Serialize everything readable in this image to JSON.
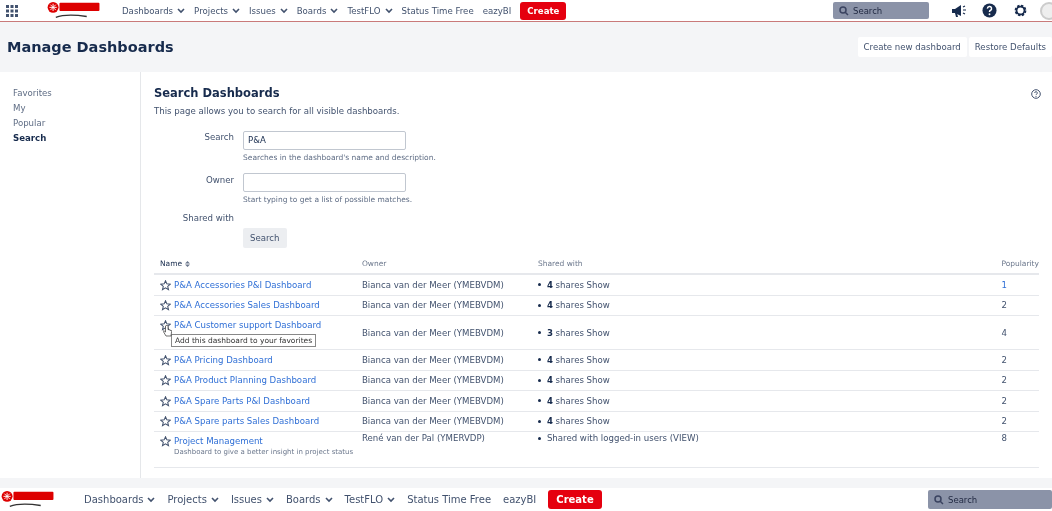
{
  "top_nav": {
    "items": [
      {
        "label": "Dashboards",
        "dropdown": true
      },
      {
        "label": "Projects",
        "dropdown": true
      },
      {
        "label": "Issues",
        "dropdown": true
      },
      {
        "label": "Boards",
        "dropdown": true
      },
      {
        "label": "TestFLO",
        "dropdown": true
      },
      {
        "label": "Status Time Free",
        "dropdown": false
      },
      {
        "label": "eazyBI",
        "dropdown": false
      }
    ],
    "create": "Create",
    "search": {
      "placeholder": "Search"
    }
  },
  "header": {
    "title": "Manage Dashboards",
    "buttons": [
      "Create new dashboard",
      "Restore Defaults"
    ]
  },
  "sidebar": {
    "items": [
      {
        "label": "Favorites",
        "selected": false
      },
      {
        "label": "My",
        "selected": false
      },
      {
        "label": "Popular",
        "selected": false
      },
      {
        "label": "Search",
        "selected": true
      }
    ]
  },
  "search_section": {
    "title": "Search Dashboards",
    "description": "This page allows you to search for all visible dashboards.",
    "fields": [
      {
        "label": "Search",
        "value": "P&A",
        "help": "Searches in the dashboard's name and description."
      },
      {
        "label": "Owner",
        "help": "Start typing to get a list of possible matches."
      }
    ],
    "shared_with_label": "Shared with",
    "button": "Search"
  },
  "table": {
    "columns": [
      "Name",
      "Owner",
      "Shared with",
      "Popularity"
    ],
    "rows": [
      {
        "name": "P&A Accessories P&I Dashboard",
        "owner": "Bianca van der Meer (YMEBVDM)",
        "shared": "**4** shares Show",
        "popularity": "1",
        "popularity_link": true
      },
      {
        "name": "P&A Accessories Sales Dashboard",
        "owner": "Bianca van der Meer (YMEBVDM)",
        "shared": "**4** shares Show",
        "popularity": "2",
        "popularity_link": false
      },
      {
        "name": "P&A Customer support Dashboard",
        "owner": "Bianca van der Meer (YMEBVDM)",
        "shared": "**3** shares Show",
        "popularity": "4",
        "popularity_link": false,
        "tooltip": "Add this dashboard to your favorites"
      },
      {
        "name": "P&A Pricing Dashboard",
        "owner": "Bianca van der Meer (YMEBVDM)",
        "shared": "**4** shares Show",
        "popularity": "2",
        "popularity_link": false
      },
      {
        "name": "P&A Product Planning Dashboard",
        "owner": "Bianca van der Meer (YMEBVDM)",
        "shared": "**4** shares Show",
        "popularity": "2",
        "popularity_link": false
      },
      {
        "name": "P&A Spare Parts P&I Dashboard",
        "owner": "Bianca van der Meer (YMEBVDM)",
        "shared": "**4** shares Show",
        "popularity": "2",
        "popularity_link": false
      },
      {
        "name": "P&A Spare parts Sales Dashboard",
        "owner": "Bianca van der Meer (YMEBVDM)",
        "shared": "**4** shares Show",
        "popularity": "2",
        "popularity_link": false
      },
      {
        "name": "Project Management",
        "description": "Dashboard to give a better insight in project status",
        "owner": "René van der Pal (YMERVDP)",
        "shared": "Shared with logged-in users (VIEW)",
        "popularity": "8",
        "popularity_link": false
      }
    ]
  },
  "bottom_nav": {
    "items": [
      {
        "label": "Dashboards",
        "dropdown": true
      },
      {
        "label": "Projects",
        "dropdown": true
      },
      {
        "label": "Issues",
        "dropdown": true
      },
      {
        "label": "Boards",
        "dropdown": true
      },
      {
        "label": "TestFLO",
        "dropdown": true
      },
      {
        "label": "Status Time Free",
        "dropdown": false
      },
      {
        "label": "eazyBI",
        "dropdown": false
      }
    ],
    "create": "Create",
    "search": {
      "placeholder": "Search"
    }
  }
}
